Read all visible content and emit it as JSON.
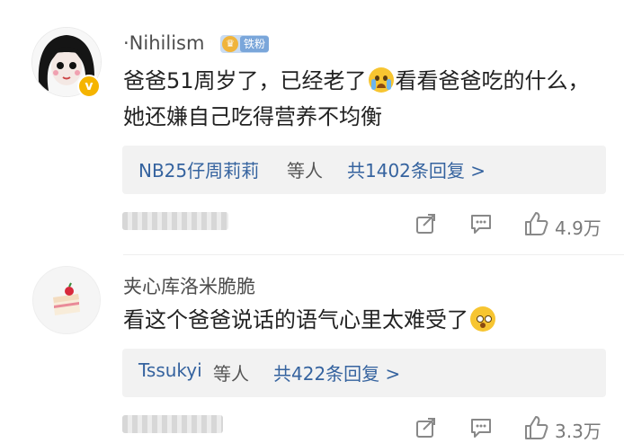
{
  "comments": [
    {
      "username": "·Nihilism",
      "fan_badge": "铁粉",
      "verified_badge": "v",
      "text_part1": "爸爸51周岁了，已经老了",
      "emoji1": "crying-emoji",
      "text_part2": "看看爸爸吃的什么，她还嫌自己吃得营养不均衡",
      "reply_summary": {
        "names": "NB25仔周莉莉",
        "middle": "等人",
        "count": "共1402条回复 >"
      },
      "like_count": "4.9万"
    },
    {
      "username": "夹心库洛米脆脆",
      "text": "看这个爸爸说话的语气心里太难受了",
      "emoji": "flushed-emoji",
      "reply_summary": {
        "names": "Tssukyi",
        "middle": "等人",
        "count": "共422条回复 >"
      },
      "like_count": "3.3万"
    }
  ],
  "colors": {
    "link": "#35639f",
    "badge_gold": "#f5b400",
    "fan_badge_bg": "#c9dcf3"
  }
}
